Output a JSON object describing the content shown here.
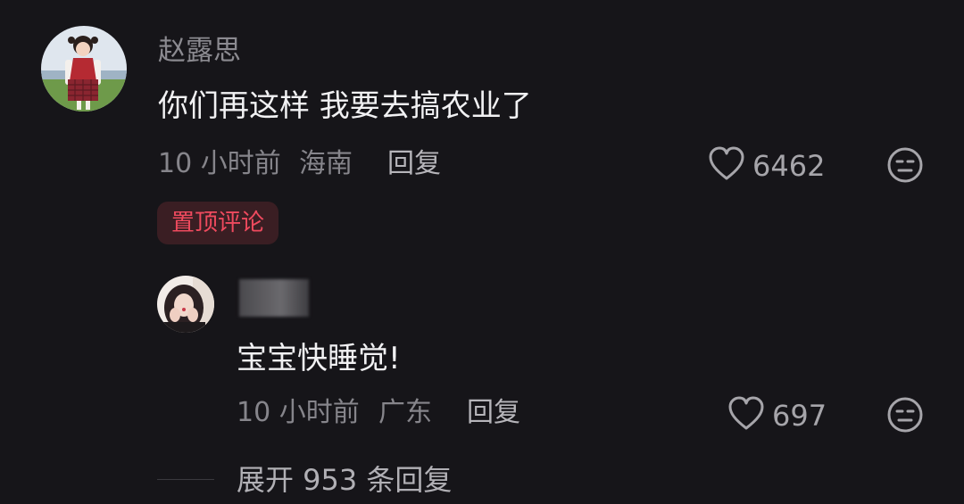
{
  "top_comment": {
    "username": "赵露思",
    "text": "你们再这样 我要去搞农业了",
    "time": "10 小时前",
    "location": "海南",
    "reply_label": "回复",
    "likes": "6462",
    "badge": "置顶评论"
  },
  "reply_comment": {
    "username": "",
    "text": "宝宝快睡觉!",
    "time": "10 小时前",
    "location": "广东",
    "reply_label": "回复",
    "likes": "697"
  },
  "expand_label": "展开 953 条回复",
  "colors": {
    "background": "#161519",
    "badge_text": "#ef4a5e",
    "badge_bg": "#3a1e23"
  },
  "icons": {
    "like": "heart-outline-icon",
    "emoji": "neutral-face-icon"
  }
}
